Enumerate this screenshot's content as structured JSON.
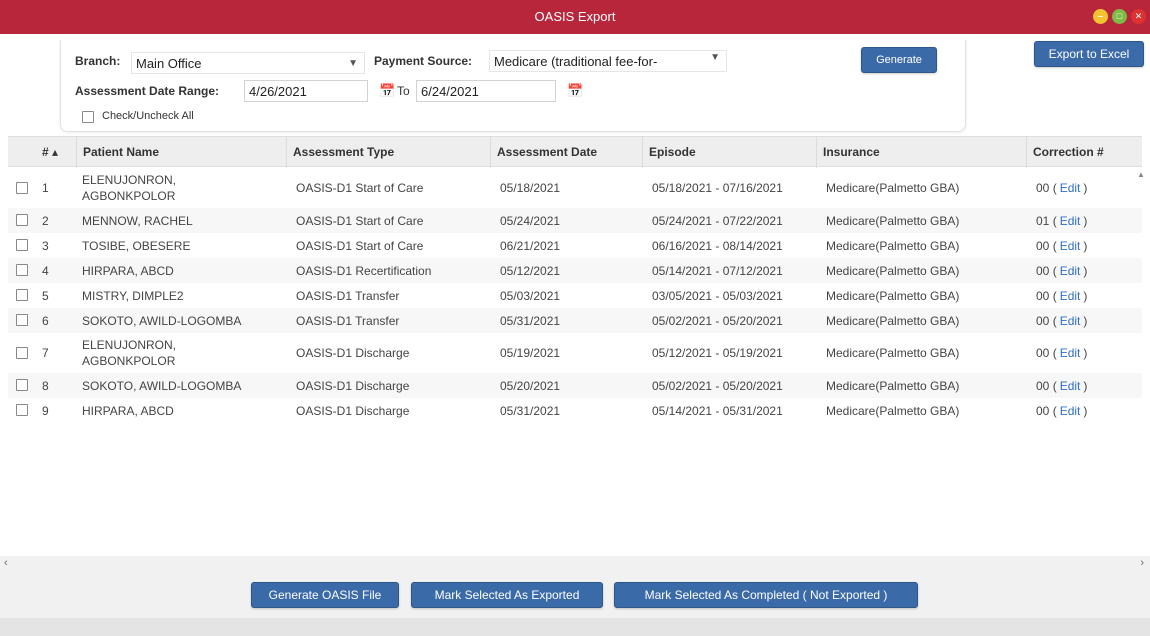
{
  "window": {
    "title": "OASIS Export"
  },
  "filters": {
    "branch_label": "Branch:",
    "branch_value": "Main Office",
    "payment_label": "Payment Source:",
    "payment_value": "Medicare (traditional fee-for-",
    "date_range_label": "Assessment Date Range:",
    "date_from": "4/26/2021",
    "to_label": "To",
    "date_to": "6/24/2021",
    "check_all_label": "Check/Uncheck All",
    "generate_label": "Generate",
    "export_excel_label": "Export to Excel"
  },
  "grid": {
    "columns": [
      "# ▴",
      "Patient Name",
      "Assessment Type",
      "Assessment Date",
      "Episode",
      "Insurance",
      "Correction #"
    ],
    "edit_label": "Edit",
    "rows": [
      {
        "num": "1",
        "patient": "ELENUJONRON, AGBONKPOLOR",
        "type": "OASIS-D1 Start of Care",
        "date": "05/18/2021",
        "episode": "05/18/2021 - 07/16/2021",
        "insurance": "Medicare(Palmetto GBA)",
        "correction": "00"
      },
      {
        "num": "2",
        "patient": "MENNOW, RACHEL",
        "type": "OASIS-D1 Start of Care",
        "date": "05/24/2021",
        "episode": "05/24/2021 - 07/22/2021",
        "insurance": "Medicare(Palmetto GBA)",
        "correction": "01"
      },
      {
        "num": "3",
        "patient": "TOSIBE, OBESERE",
        "type": "OASIS-D1 Start of Care",
        "date": "06/21/2021",
        "episode": "06/16/2021 - 08/14/2021",
        "insurance": "Medicare(Palmetto GBA)",
        "correction": "00"
      },
      {
        "num": "4",
        "patient": "HIRPARA, ABCD",
        "type": "OASIS-D1 Recertification",
        "date": "05/12/2021",
        "episode": "05/14/2021 - 07/12/2021",
        "insurance": "Medicare(Palmetto GBA)",
        "correction": "00"
      },
      {
        "num": "5",
        "patient": "MISTRY, DIMPLE2",
        "type": "OASIS-D1 Transfer",
        "date": "05/03/2021",
        "episode": "03/05/2021 - 05/03/2021",
        "insurance": "Medicare(Palmetto GBA)",
        "correction": "00"
      },
      {
        "num": "6",
        "patient": "SOKOTO, AWILD-LOGOMBA",
        "type": "OASIS-D1 Transfer",
        "date": "05/31/2021",
        "episode": "05/02/2021 - 05/20/2021",
        "insurance": "Medicare(Palmetto GBA)",
        "correction": "00"
      },
      {
        "num": "7",
        "patient": "ELENUJONRON, AGBONKPOLOR",
        "type": "OASIS-D1 Discharge",
        "date": "05/19/2021",
        "episode": "05/12/2021 - 05/19/2021",
        "insurance": "Medicare(Palmetto GBA)",
        "correction": "00"
      },
      {
        "num": "8",
        "patient": "SOKOTO, AWILD-LOGOMBA",
        "type": "OASIS-D1 Discharge",
        "date": "05/20/2021",
        "episode": "05/02/2021 - 05/20/2021",
        "insurance": "Medicare(Palmetto GBA)",
        "correction": "00"
      },
      {
        "num": "9",
        "patient": "HIRPARA, ABCD",
        "type": "OASIS-D1 Discharge",
        "date": "05/31/2021",
        "episode": "05/14/2021 - 05/31/2021",
        "insurance": "Medicare(Palmetto GBA)",
        "correction": "00"
      }
    ]
  },
  "actions": {
    "generate_file_label": "Generate OASIS File",
    "mark_exported_label": "Mark Selected As Exported",
    "mark_completed_label": "Mark Selected As Completed ( Not Exported )"
  },
  "colors": {
    "titlebar": "#b8263c",
    "button": "#3a6aa8",
    "link": "#2f6fc7"
  }
}
